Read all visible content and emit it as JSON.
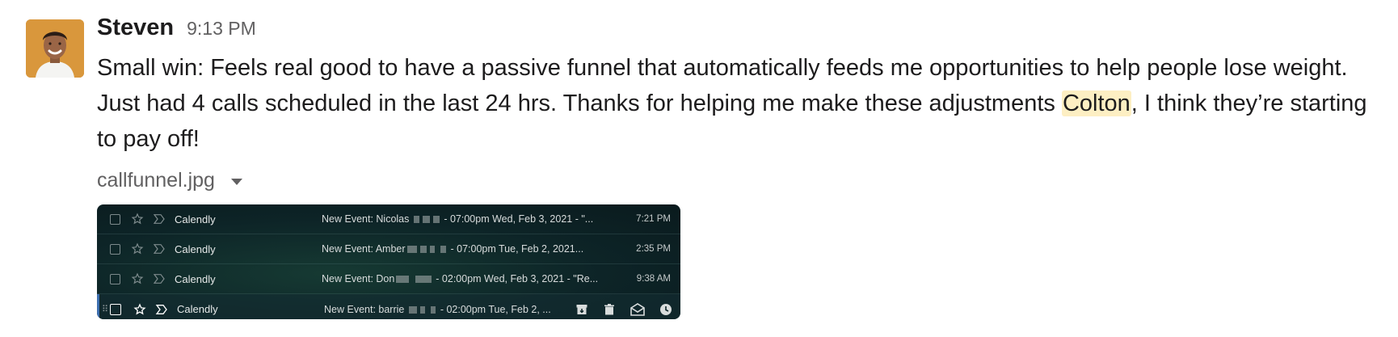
{
  "message": {
    "author": "Steven",
    "time": "9:13 PM",
    "text_part1": "Small win: Feels real good to have a passive funnel that automatically feeds me opportunities to help people lose weight. Just had 4 calls scheduled in the last 24 hrs. Thanks for helping me make these adjustments ",
    "mention": "Colton",
    "text_part2": ", I think they’re starting to pay off!",
    "file_name": "callfunnel.jpg"
  },
  "emails": [
    {
      "sender": "Calendly",
      "subject_start": "New Event: Nicolas",
      "subject_end": "- 07:00pm Wed, Feb 3, 2021 - \"...",
      "time": "7:21 PM"
    },
    {
      "sender": "Calendly",
      "subject_start": "New Event: Amber",
      "subject_end": "- 07:00pm Tue, Feb 2, 2021...",
      "time": "2:35 PM"
    },
    {
      "sender": "Calendly",
      "subject_start": "New Event: Don",
      "subject_end": "- 02:00pm Wed, Feb 3, 2021 - \"Re...",
      "time": "9:38 AM"
    },
    {
      "sender": "Calendly",
      "subject_start": "New Event: barrie",
      "subject_end": "- 02:00pm Tue, Feb 2, ...",
      "time": ""
    }
  ],
  "icons": {
    "avatar": "user-avatar",
    "file_caret": "caret-down-icon",
    "checkbox": "checkbox-icon",
    "star": "star-icon",
    "important": "important-marker-icon",
    "archive": "archive-icon",
    "delete": "trash-icon",
    "mark_read": "mark-read-icon",
    "snooze": "snooze-clock-icon"
  },
  "colors": {
    "mention_bg": "#fdefc3",
    "muted_text": "#616061",
    "email_bg": "#0d2427"
  }
}
